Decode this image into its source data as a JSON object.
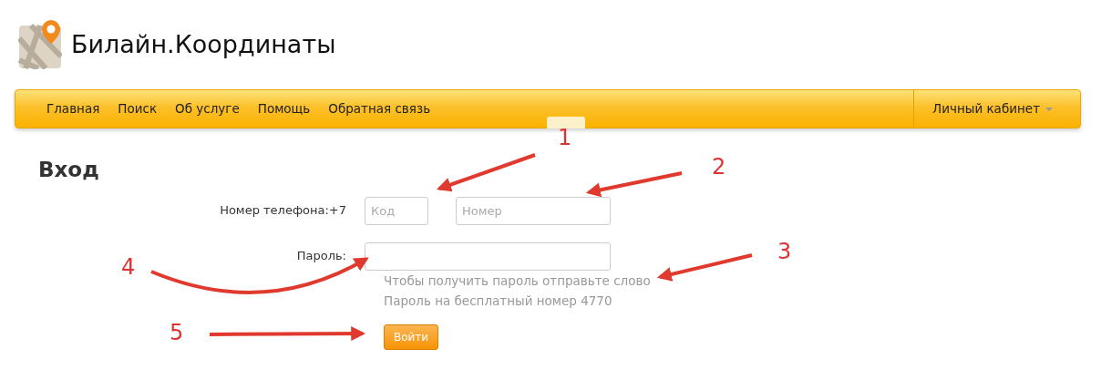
{
  "brand": {
    "title": "Билайн.Координаты"
  },
  "navbar": {
    "items": [
      {
        "label": "Главная"
      },
      {
        "label": "Поиск"
      },
      {
        "label": "Об услуге"
      },
      {
        "label": "Помощь"
      },
      {
        "label": "Обратная связь"
      }
    ],
    "account": {
      "label": "Личный кабинет"
    }
  },
  "form": {
    "heading": "Вход",
    "phone": {
      "label": "Номер телефона:+7",
      "code_placeholder": "Код",
      "number_placeholder": "Номер"
    },
    "password": {
      "label": "Пароль:",
      "hint": "Чтобы получить пароль отправьте слово Пароль на бесплатный номер 4770"
    },
    "submit": "Войти"
  },
  "annotations": [
    {
      "label": "1"
    },
    {
      "label": "2"
    },
    {
      "label": "3"
    },
    {
      "label": "4"
    },
    {
      "label": "5"
    }
  ]
}
